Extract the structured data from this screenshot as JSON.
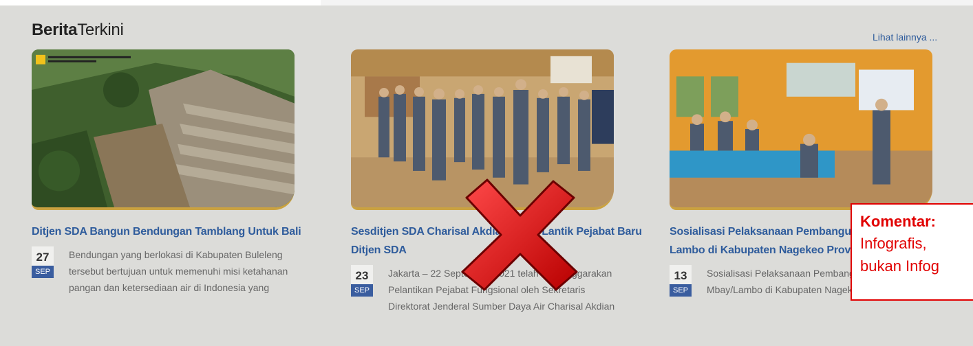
{
  "section": {
    "title_bold": "Berita",
    "title_rest": "Terkini",
    "see_more": "Lihat lainnya ..."
  },
  "cards": [
    {
      "title": "Ditjen SDA Bangun Bendungan Tamblang Untuk Bali",
      "day": "27",
      "month": "SEP",
      "excerpt": "Bendungan yang berlokasi di Kabupaten Buleleng tersebut bertujuan untuk memenuhi misi ketahanan pangan dan ketersediaan air di Indonesia yang",
      "image_caption": "PEMBANGUNAN BENDUNGAN TAMBLANG DI BALI SUBLENG",
      "image_icon": "ministry-logo"
    },
    {
      "title": "Sesditjen SDA Charisal Akdian Manu Lantik Pejabat Baru Ditjen SDA",
      "day": "23",
      "month": "SEP",
      "excerpt": "Jakarta – 22 September 2021 telah diselenggarakan Pelantikan Pejabat Fungsional oleh Sekretaris Direktorat Jenderal Sumber Daya Air Charisal Akdian"
    },
    {
      "title": "Sosialisasi Pelaksanaan Pembangunan Bendungan Mbay Lambo di Kabupaten Nagekeo Provinsi NTT",
      "day": "13",
      "month": "SEP",
      "excerpt": "Sosialisasi Pelaksanaan Pembangunan Bendungan Mbay/Lambo di Kabupaten Nagekeo-NTT"
    }
  ],
  "annotation": {
    "icon": "red-x-icon",
    "heading": "Komentar:",
    "line1": "Infografis,",
    "line2": "bukan Infog",
    "color": "#e10000"
  },
  "colors": {
    "accent_blue": "#2f5c9c",
    "gold": "#caa241",
    "date_blue": "#3a5d9f"
  }
}
